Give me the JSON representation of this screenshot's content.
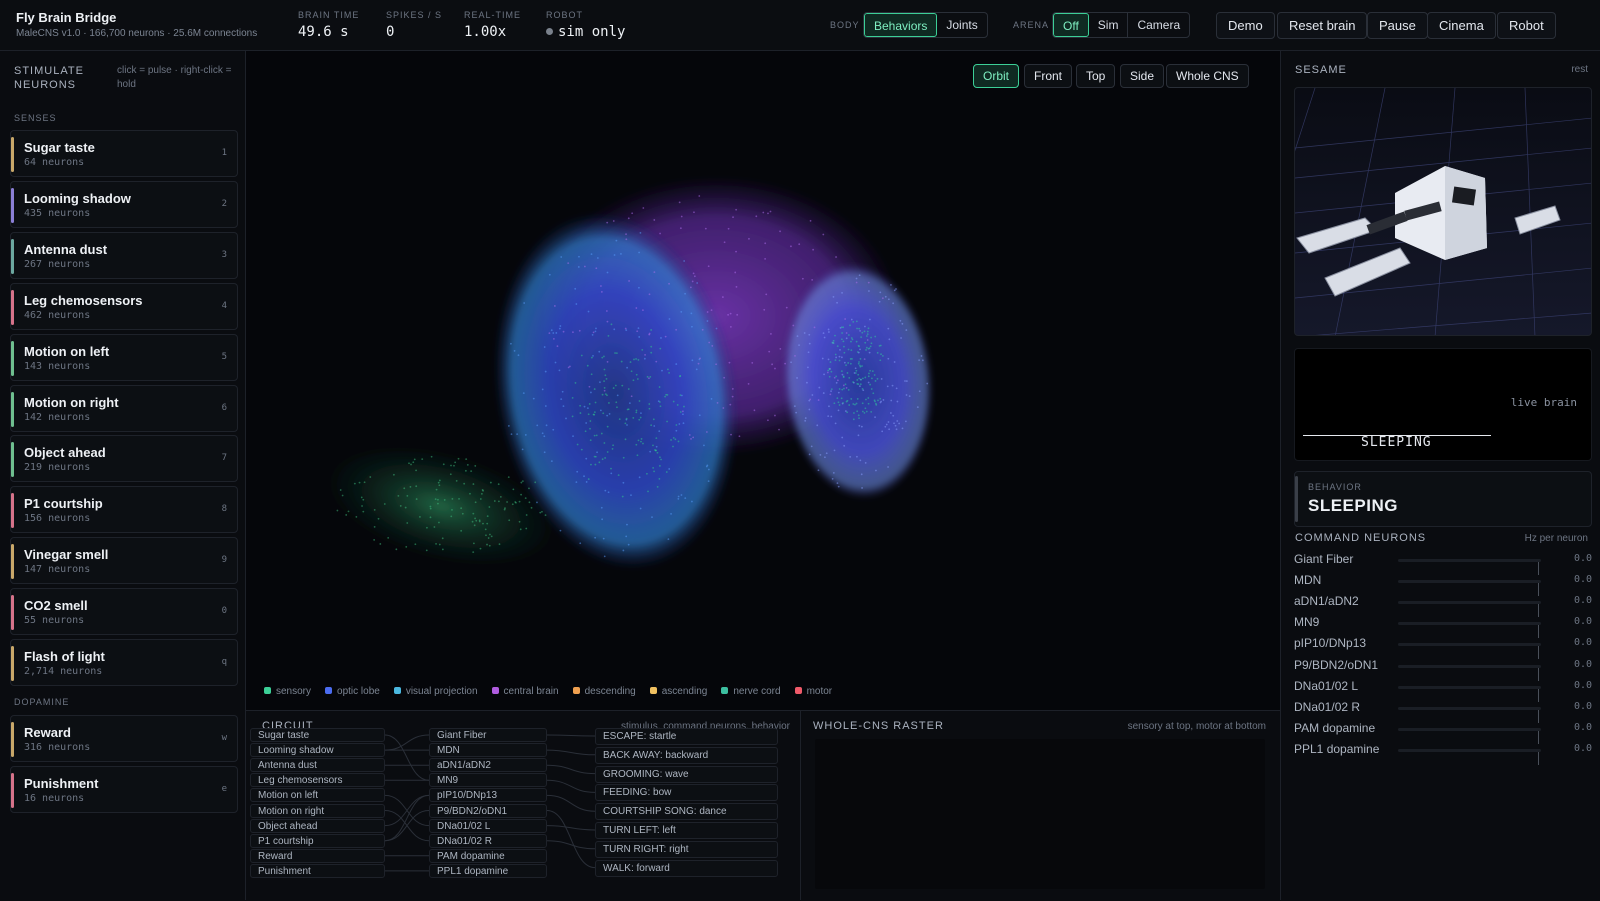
{
  "app": {
    "title": "Fly Brain Bridge",
    "subtitle": "MaleCNS v1.0 · 166,700 neurons · 25.6M connections"
  },
  "stats": [
    {
      "label": "BRAIN TIME",
      "value": "49.6 s"
    },
    {
      "label": "SPIKES / S",
      "value": "0"
    },
    {
      "label": "REAL-TIME",
      "value": "1.00x"
    },
    {
      "label": "ROBOT",
      "value": "sim only"
    }
  ],
  "body": {
    "label": "BODY",
    "options": [
      "Behaviors",
      "Joints"
    ],
    "selected": "Behaviors"
  },
  "arena": {
    "label": "ARENA",
    "options": [
      "Off",
      "Sim",
      "Camera"
    ],
    "selected": "Off"
  },
  "actions": [
    "Demo",
    "Reset brain",
    "Pause",
    "Cinema",
    "Robot"
  ],
  "stimulate": {
    "title": "STIMULATE NEURONS",
    "hint": "click = pulse · right-click = hold"
  },
  "senses": {
    "label": "SENSES",
    "items": [
      {
        "name": "Sugar taste",
        "count": "64 neurons",
        "key": "1",
        "color": "#c9a86a"
      },
      {
        "name": "Looming shadow",
        "count": "435 neurons",
        "key": "2",
        "color": "#8b7fd6"
      },
      {
        "name": "Antenna dust",
        "count": "267 neurons",
        "key": "3",
        "color": "#6ca8a0"
      },
      {
        "name": "Leg chemosensors",
        "count": "462 neurons",
        "key": "4",
        "color": "#d6738a"
      },
      {
        "name": "Motion on left",
        "count": "143 neurons",
        "key": "5",
        "color": "#6fbf8f"
      },
      {
        "name": "Motion on right",
        "count": "142 neurons",
        "key": "6",
        "color": "#6fbf8f"
      },
      {
        "name": "Object ahead",
        "count": "219 neurons",
        "key": "7",
        "color": "#6fbf8f"
      },
      {
        "name": "P1 courtship",
        "count": "156 neurons",
        "key": "8",
        "color": "#d6738a"
      },
      {
        "name": "Vinegar smell",
        "count": "147 neurons",
        "key": "9",
        "color": "#c9a86a"
      },
      {
        "name": "CO2 smell",
        "count": "55 neurons",
        "key": "0",
        "color": "#d6738a"
      },
      {
        "name": "Flash of light",
        "count": "2,714 neurons",
        "key": "q",
        "color": "#c9a86a"
      }
    ]
  },
  "dopamine": {
    "label": "DOPAMINE",
    "items": [
      {
        "name": "Reward",
        "count": "316 neurons",
        "key": "w",
        "color": "#c9a86a"
      },
      {
        "name": "Punishment",
        "count": "16 neurons",
        "key": "e",
        "color": "#d6738a"
      }
    ]
  },
  "views": [
    "Orbit",
    "Front",
    "Top",
    "Side",
    "Whole CNS"
  ],
  "view_selected": "Orbit",
  "legend": [
    {
      "label": "sensory",
      "color": "#3ccf97"
    },
    {
      "label": "optic lobe",
      "color": "#4b6cf0"
    },
    {
      "label": "visual projection",
      "color": "#4bb8e0"
    },
    {
      "label": "central brain",
      "color": "#b05ce0"
    },
    {
      "label": "descending",
      "color": "#f0a050"
    },
    {
      "label": "ascending",
      "color": "#f0c060"
    },
    {
      "label": "nerve cord",
      "color": "#3cbfa0"
    },
    {
      "label": "motor",
      "color": "#f05a6a"
    }
  ],
  "circuit": {
    "title": "CIRCUIT",
    "hint": "stimulus, command neurons, behavior",
    "inputs": [
      "Sugar taste",
      "Looming shadow",
      "Antenna dust",
      "Leg chemosensors",
      "Motion on left",
      "Motion on right",
      "Object ahead",
      "P1 courtship",
      "Reward",
      "Punishment"
    ],
    "commands": [
      "Giant Fiber",
      "MDN",
      "aDN1/aDN2",
      "MN9",
      "pIP10/DNp13",
      "P9/BDN2/oDN1",
      "DNa01/02 L",
      "DNa01/02 R",
      "PAM dopamine",
      "PPL1 dopamine"
    ],
    "behaviors": [
      "ESCAPE: startle",
      "BACK AWAY: backward",
      "GROOMING: wave",
      "FEEDING: bow",
      "COURTSHIP SONG: dance",
      "TURN LEFT: left",
      "TURN RIGHT: right",
      "WALK: forward"
    ]
  },
  "raster": {
    "title": "WHOLE-CNS RASTER",
    "hint": "sensory at top, motor at bottom"
  },
  "sesame": {
    "title": "SESAME",
    "status": "rest"
  },
  "live_brain": {
    "label": "live brain",
    "state": "SLEEPING"
  },
  "behavior": {
    "label": "BEHAVIOR",
    "value": "SLEEPING"
  },
  "command_neurons": {
    "title": "COMMAND NEURONS",
    "unit": "Hz per neuron",
    "items": [
      {
        "name": "Giant Fiber",
        "value": "0.0"
      },
      {
        "name": "MDN",
        "value": "0.0"
      },
      {
        "name": "aDN1/aDN2",
        "value": "0.0"
      },
      {
        "name": "MN9",
        "value": "0.0"
      },
      {
        "name": "pIP10/DNp13",
        "value": "0.0"
      },
      {
        "name": "P9/BDN2/oDN1",
        "value": "0.0"
      },
      {
        "name": "DNa01/02 L",
        "value": "0.0"
      },
      {
        "name": "DNa01/02 R",
        "value": "0.0"
      },
      {
        "name": "PAM dopamine",
        "value": "0.0"
      },
      {
        "name": "PPL1 dopamine",
        "value": "0.0"
      }
    ]
  },
  "colors": {
    "accent": "#3ccf97",
    "background": "#0a0c10"
  }
}
